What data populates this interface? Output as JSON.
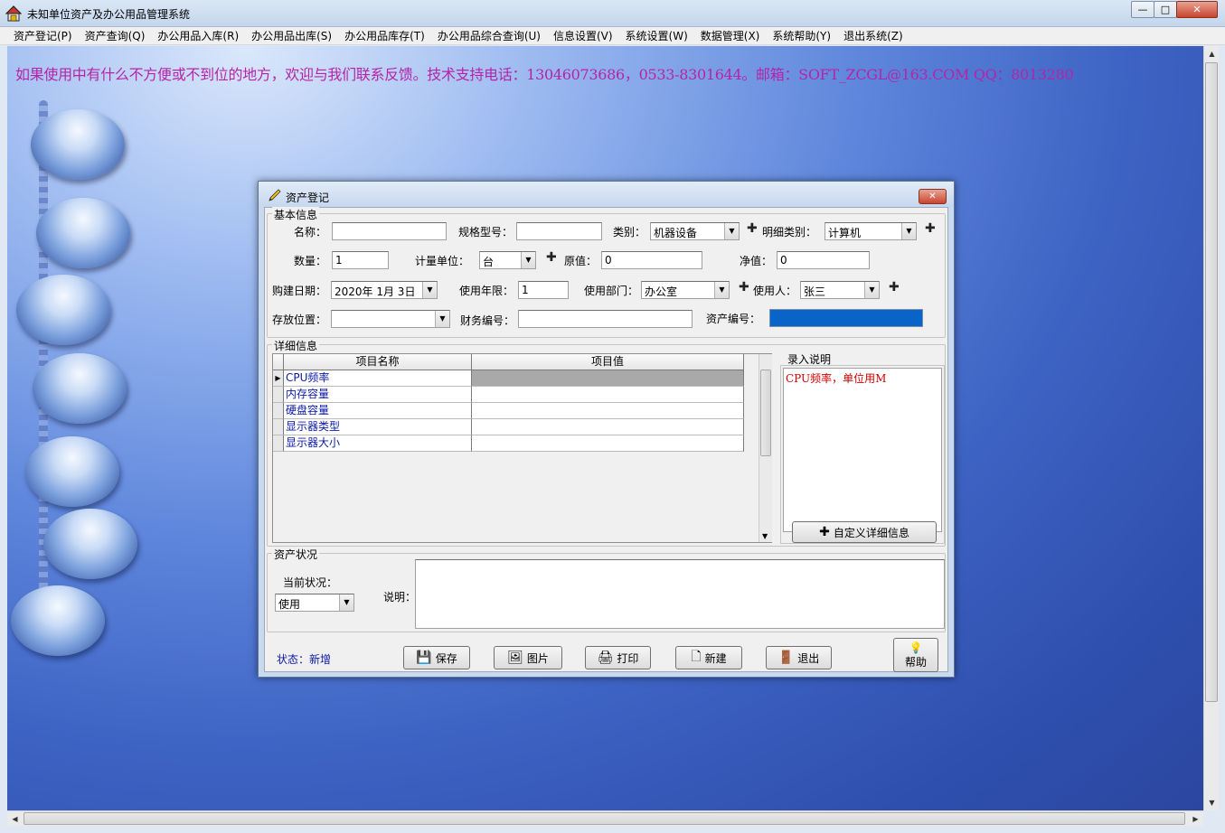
{
  "window": {
    "title": "未知单位资产及办公用品管理系统",
    "buttons": {
      "minimize": "—",
      "maximize": "□",
      "close": "✕"
    }
  },
  "menu": [
    "资产登记(P)",
    "资产查询(Q)",
    "办公用品入库(R)",
    "办公用品出库(S)",
    "办公用品库存(T)",
    "办公用品综合查询(U)",
    "信息设置(V)",
    "系统设置(W)",
    "数据管理(X)",
    "系统帮助(Y)",
    "退出系统(Z)"
  ],
  "notice": "如果使用中有什么不方便或不到位的地方，欢迎与我们联系反馈。技术支持电话：13046073686，0533-8301644。邮箱：SOFT_ZCGL@163.COM QQ：8013280",
  "dialog": {
    "title": "资产登记",
    "basic": {
      "group_label": "基本信息",
      "name_label": "名称：",
      "name_value": "",
      "spec_label": "规格型号：",
      "spec_value": "",
      "category_label": "类别：",
      "category_value": "机器设备",
      "detail_category_label": "明细类别：",
      "detail_category_value": "计算机",
      "qty_label": "数量：",
      "qty_value": "1",
      "unit_label": "计量单位：",
      "unit_value": "台",
      "orig_label": "原值：",
      "orig_value": "0",
      "net_label": "净值：",
      "net_value": "0",
      "buy_date_label": "购建日期：",
      "buy_date_value": "2020年 1月 3日",
      "years_label": "使用年限：",
      "years_value": "1",
      "dept_label": "使用部门：",
      "dept_value": "办公室",
      "user_label": "使用人：",
      "user_value": "张三",
      "location_label": "存放位置：",
      "location_value": "",
      "finance_label": "财务编号：",
      "finance_value": "",
      "asset_no_label": "资产编号：",
      "asset_no_value": ""
    },
    "detail": {
      "group_label": "详细信息",
      "columns": [
        "项目名称",
        "项目值"
      ],
      "rows": [
        {
          "name": "CPU频率",
          "value": ""
        },
        {
          "name": "内存容量",
          "value": ""
        },
        {
          "name": "硬盘容量",
          "value": ""
        },
        {
          "name": "显示器类型",
          "value": ""
        },
        {
          "name": "显示器大小",
          "value": ""
        }
      ],
      "note_label": "录入说明",
      "note_text": "CPU频率，单位用M",
      "custom_button": "自定义详细信息"
    },
    "status_group": {
      "group_label": "资产状况",
      "current_label": "当前状况：",
      "current_value": "使用",
      "desc_label": "说明：",
      "desc_value": ""
    },
    "status_text": "状态：新增",
    "buttons": {
      "save": "保存",
      "picture": "图片",
      "print": "打印",
      "new": "新建",
      "exit": "退出",
      "help": "帮助"
    }
  }
}
